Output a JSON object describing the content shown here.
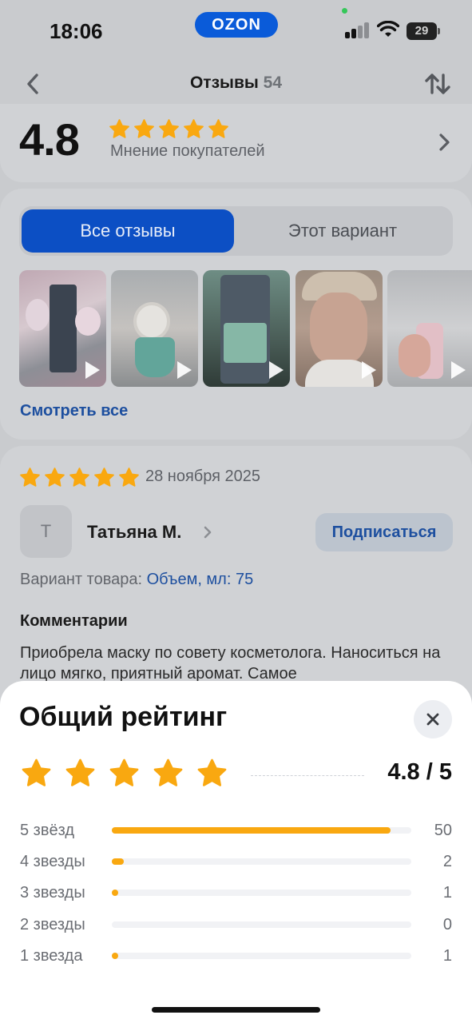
{
  "status_bar": {
    "time": "18:06",
    "brand": "OZON",
    "battery": "29"
  },
  "header": {
    "title": "Отзывы",
    "count": "54"
  },
  "summary": {
    "rating": "4.8",
    "subtitle": "Мнение покупателей",
    "stars": 5
  },
  "tabs": [
    {
      "label": "Все отзывы",
      "active": true
    },
    {
      "label": "Этот вариант",
      "active": false
    }
  ],
  "media": {
    "see_all": "Смотреть все",
    "thumbnails": [
      "video",
      "video",
      "video",
      "video",
      "video"
    ]
  },
  "review": {
    "stars": 5,
    "date": "28 ноября 2025",
    "avatar_letter": "Т",
    "author": "Татьяна М.",
    "subscribe": "Подписаться",
    "variant_label": "Вариант товара:",
    "variant_value": "Объем, мл: 75",
    "comments_heading": "Комментарии",
    "comment": "Приобрела маску по совету косметолога. Наноситься на лицо мягко, приятный аромат. Самое"
  },
  "sheet": {
    "title": "Общий рейтинг",
    "score": "4.8 / 5",
    "stars": 5,
    "rows": [
      {
        "label": "5 звёзд",
        "count": "50",
        "fraction": 0.93
      },
      {
        "label": "4 звезды",
        "count": "2",
        "fraction": 0.04
      },
      {
        "label": "3 звезды",
        "count": "1",
        "fraction": 0.02
      },
      {
        "label": "2 звезды",
        "count": "0",
        "fraction": 0
      },
      {
        "label": "1 звезда",
        "count": "1",
        "fraction": 0.02
      }
    ]
  },
  "colors": {
    "accent": "#0c4fc4",
    "star": "#f9a810",
    "link": "#1d4f9f"
  }
}
